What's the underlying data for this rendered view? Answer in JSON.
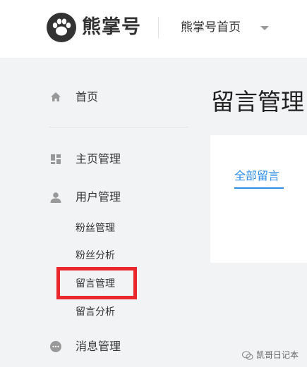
{
  "header": {
    "brand": "熊掌号",
    "home_link": "熊掌号首页"
  },
  "sidebar": {
    "home": "首页",
    "homepage_manage": "主页管理",
    "user_manage": "用户管理",
    "sub_items": [
      "粉丝管理",
      "粉丝分析",
      "留言管理",
      "留言分析"
    ],
    "message_manage": "消息管理",
    "highlighted": "留言管理"
  },
  "main": {
    "title": "留言管理",
    "tab_all": "全部留言"
  },
  "watermark": {
    "text": "凯哥日记本"
  },
  "colors": {
    "accent": "#2c8ee8",
    "highlight": "#e8262c",
    "background": "#f2f3f5"
  }
}
